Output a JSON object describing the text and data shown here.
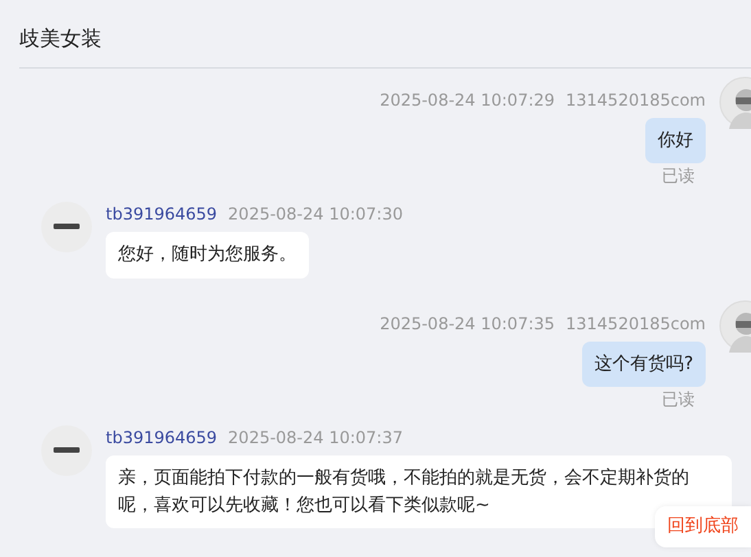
{
  "header": {
    "title": "歧美女装"
  },
  "messages": [
    {
      "kind": "sent",
      "time": "2025-08-24 10:07:29",
      "user": "1314520185com",
      "text": "你好",
      "status": "已读"
    },
    {
      "kind": "received",
      "user": "tb391964659",
      "time": "2025-08-24 10:07:30",
      "text": "您好，随时为您服务。"
    },
    {
      "kind": "sent",
      "time": "2025-08-24 10:07:35",
      "user": "1314520185com",
      "text": "这个有货吗?",
      "status": "已读"
    },
    {
      "kind": "received",
      "user": "tb391964659",
      "time": "2025-08-24 10:07:37",
      "text": "亲，页面能拍下付款的一般有货哦，不能拍的就是无货，会不定期补货的呢，喜欢可以先收藏！您也可以看下类似款呢~"
    }
  ],
  "back_to_bottom": {
    "label": "回到底部"
  }
}
